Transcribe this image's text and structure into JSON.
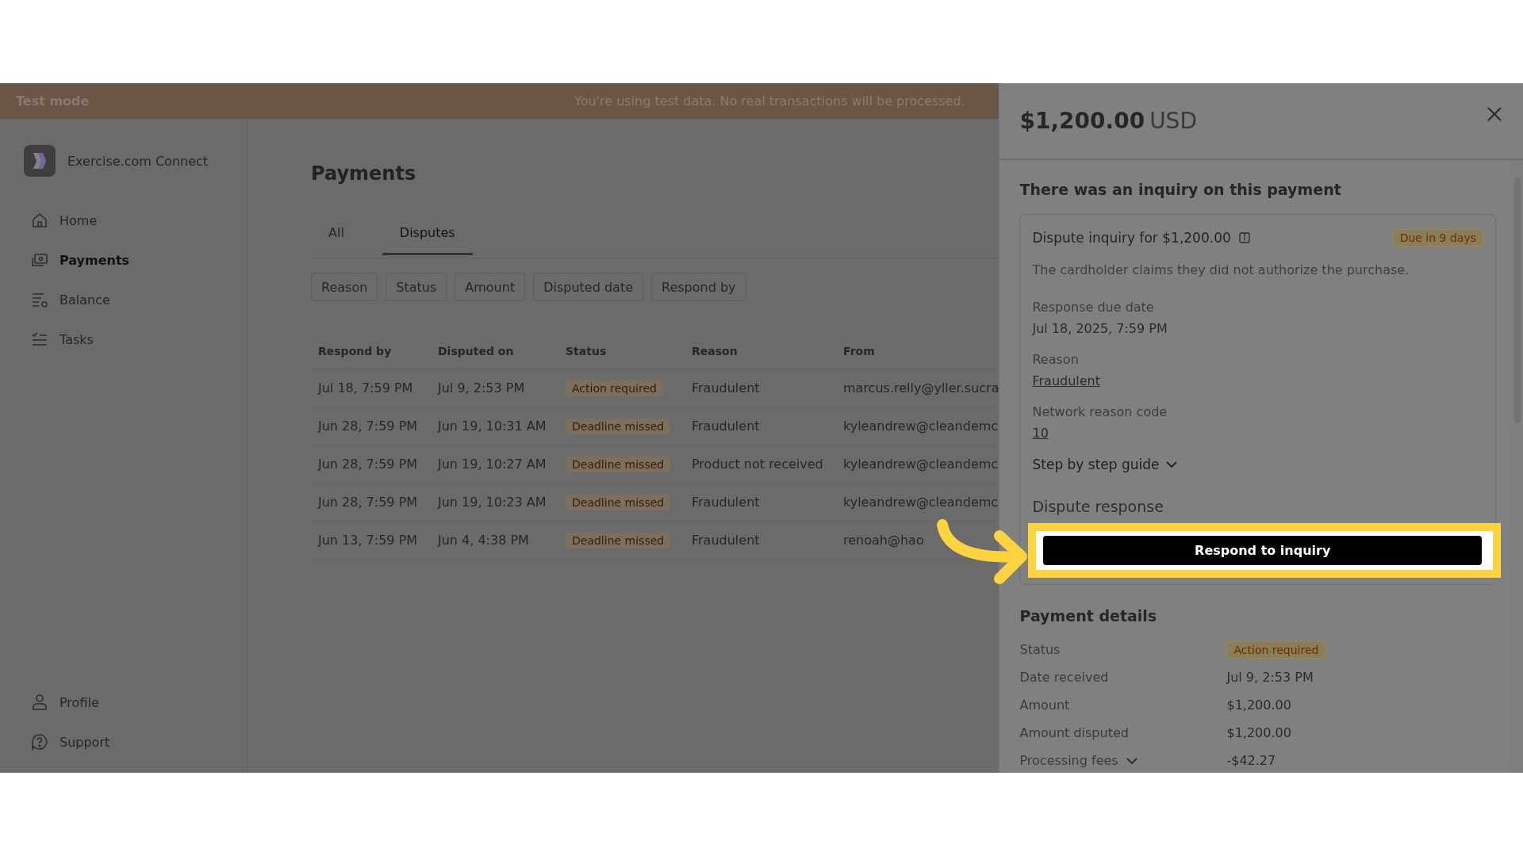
{
  "banner": {
    "label": "Test mode",
    "message": "You're using test data. No real transactions will be processed."
  },
  "sidebar": {
    "brand": "Exercise.com Connect",
    "items": [
      {
        "label": "Home",
        "selected": false
      },
      {
        "label": "Payments",
        "selected": true
      },
      {
        "label": "Balance",
        "selected": false
      },
      {
        "label": "Tasks",
        "selected": false
      }
    ],
    "bottom_items": [
      {
        "label": "Profile",
        "selected": false
      },
      {
        "label": "Support",
        "selected": false
      }
    ]
  },
  "page": {
    "title": "Payments",
    "tabs": [
      {
        "label": "All",
        "selected": false
      },
      {
        "label": "Disputes",
        "selected": true
      }
    ],
    "filters": [
      "Reason",
      "Status",
      "Amount",
      "Disputed date",
      "Respond by"
    ],
    "table": {
      "columns": [
        "Respond by",
        "Disputed on",
        "Status",
        "Reason",
        "From"
      ],
      "rows": [
        {
          "respond_by": "Jul 18, 7:59 PM",
          "disputed_on": "Jul 9, 2:53 PM",
          "status": "Action required",
          "reason": "Fraudulent",
          "from": "marcus.relly@yller.sucra"
        },
        {
          "respond_by": "Jun 28, 7:59 PM",
          "disputed_on": "Jun 19, 10:31 AM",
          "status": "Deadline missed",
          "reason": "Fraudulent",
          "from": "kyleandrew@cleandemc"
        },
        {
          "respond_by": "Jun 28, 7:59 PM",
          "disputed_on": "Jun 19, 10:27 AM",
          "status": "Deadline missed",
          "reason": "Product not received",
          "from": "kyleandrew@cleandemc"
        },
        {
          "respond_by": "Jun 28, 7:59 PM",
          "disputed_on": "Jun 19, 10:23 AM",
          "status": "Deadline missed",
          "reason": "Fraudulent",
          "from": "kyleandrew@cleandemc"
        },
        {
          "respond_by": "Jun 13, 7:59 PM",
          "disputed_on": "Jun 4, 4:38 PM",
          "status": "Deadline missed",
          "reason": "Fraudulent",
          "from": "renoah@hao"
        }
      ]
    }
  },
  "panel": {
    "amount": "$1,200.00",
    "currency": "USD",
    "inquiry": {
      "heading": "There was an inquiry on this payment",
      "title": "Dispute inquiry for $1,200.00",
      "badge": "Due in 9 days",
      "description": "The cardholder claims they did not authorize the purchase.",
      "fields": [
        {
          "label": "Response due date",
          "value": "Jul 18, 2025, 7:59 PM",
          "kind": "text"
        },
        {
          "label": "Reason",
          "value": "Fraudulent",
          "kind": "link"
        },
        {
          "label": "Network reason code",
          "value": "10",
          "kind": "link"
        }
      ],
      "guide": "Step by step guide",
      "response_heading": "Dispute response",
      "button": "Respond to inquiry"
    },
    "details": {
      "heading": "Payment details",
      "rows": [
        {
          "label": "Status",
          "value": "Action required",
          "kind": "badge"
        },
        {
          "label": "Date received",
          "value": "Jul 9, 2:53 PM",
          "kind": "text"
        },
        {
          "label": "Amount",
          "value": "$1,200.00",
          "kind": "text"
        },
        {
          "label": "Amount disputed",
          "value": "$1,200.00",
          "kind": "text"
        },
        {
          "label": "Processing fees",
          "value": "-$42.27",
          "kind": "expandable"
        }
      ]
    }
  }
}
